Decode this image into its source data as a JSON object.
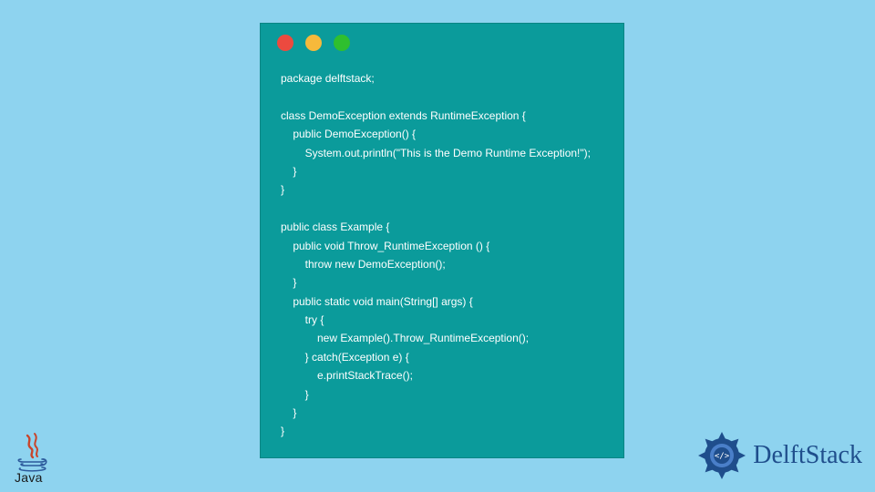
{
  "code": {
    "lines": [
      "package delftstack;",
      "",
      "class DemoException extends RuntimeException {",
      "    public DemoException() {",
      "        System.out.println(\"This is the Demo Runtime Exception!\");",
      "    }",
      "}",
      "",
      "public class Example {",
      "    public void Throw_RuntimeException () {",
      "        throw new DemoException();",
      "    }",
      "    public static void main(String[] args) {",
      "        try {",
      "            new Example().Throw_RuntimeException();",
      "        } catch(Exception e) {",
      "            e.printStackTrace();",
      "        }",
      "    }",
      "}"
    ]
  },
  "logos": {
    "java_label": "Java",
    "delft_label": "DelftStack"
  },
  "traffic": {
    "red": "close-icon",
    "yellow": "minimize-icon",
    "green": "maximize-icon"
  }
}
